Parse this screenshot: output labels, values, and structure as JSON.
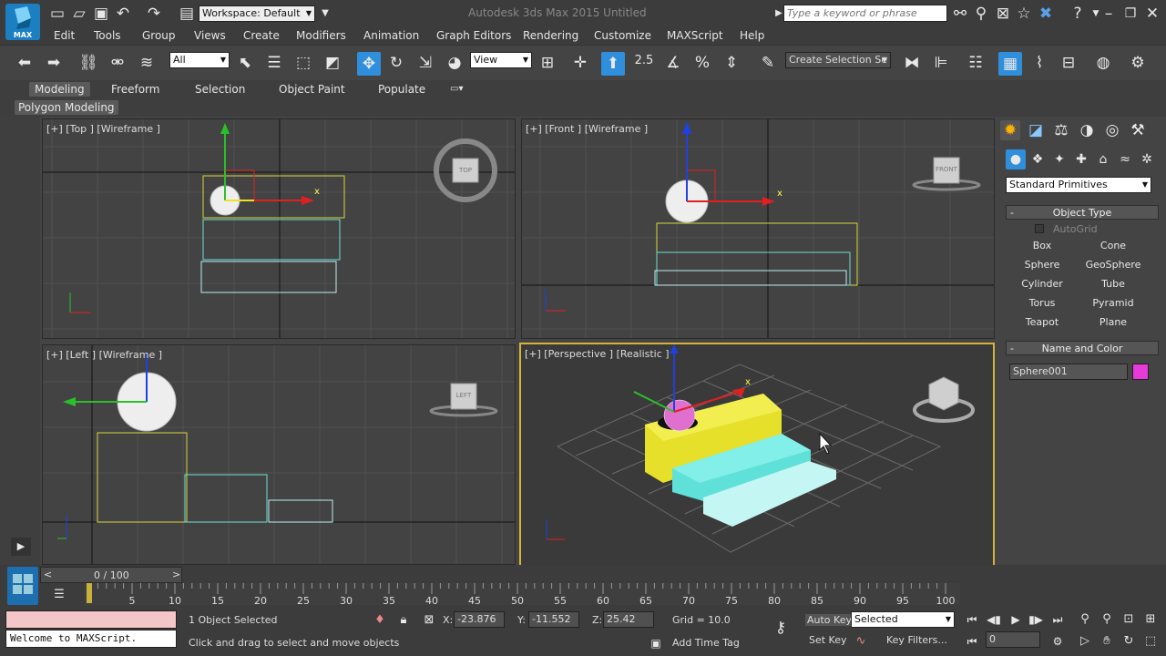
{
  "titlebar": {
    "app_logo": "MAX",
    "workspace_label": "Workspace: Default",
    "title": "Autodesk 3ds Max 2015    Untitled",
    "search_placeholder": "Type a keyword or phrase"
  },
  "menu": [
    "Edit",
    "Tools",
    "Group",
    "Views",
    "Create",
    "Modifiers",
    "Animation",
    "Graph Editors",
    "Rendering",
    "Customize",
    "MAXScript",
    "Help"
  ],
  "toolbar": {
    "selection_filter": "All",
    "ref_coord": "View",
    "snap_angle": "2.5",
    "named_selection_placeholder": "Create Selection Se"
  },
  "ribbon": {
    "tabs": [
      "Modeling",
      "Freeform",
      "Selection",
      "Object Paint",
      "Populate"
    ],
    "sub_label": "Polygon Modeling"
  },
  "viewports": {
    "top": {
      "label": "[+] [Top ] [Wireframe ]",
      "cube": "TOP"
    },
    "front": {
      "label": "[+] [Front ] [Wireframe ]",
      "cube": "FRONT"
    },
    "left": {
      "label": "[+] [Left ] [Wireframe ]",
      "cube": "LEFT"
    },
    "perspective": {
      "label": "[+] [Perspective ] [Realistic ]"
    },
    "axis_x": "x"
  },
  "command_panel": {
    "category": "Standard Primitives",
    "object_type_title": "Object Type",
    "autogrid": "AutoGrid",
    "buttons": [
      [
        "Box",
        "Cone"
      ],
      [
        "Sphere",
        "GeoSphere"
      ],
      [
        "Cylinder",
        "Tube"
      ],
      [
        "Torus",
        "Pyramid"
      ],
      [
        "Teapot",
        "Plane"
      ]
    ],
    "name_color_title": "Name and Color",
    "object_name": "Sphere001",
    "object_color": "#e83ad8"
  },
  "timeline": {
    "frame_counter": "0 / 100",
    "ticks": [
      "5",
      "10",
      "15",
      "20",
      "25",
      "30",
      "35",
      "40",
      "45",
      "50",
      "55",
      "60",
      "65",
      "70",
      "75",
      "80",
      "85",
      "90",
      "95",
      "100"
    ]
  },
  "status": {
    "maxscript_line": "Welcome to MAXScript.",
    "selection": "1 Object Selected",
    "prompt": "Click and drag to select and move objects",
    "x_label": "X:",
    "x_value": "-23.876",
    "y_label": "Y:",
    "y_value": "-11.552",
    "z_label": "Z:",
    "z_value": "25.42",
    "grid": "Grid = 10.0",
    "add_time_tag": "Add Time Tag",
    "auto_key": "Auto Key",
    "set_key": "Set Key",
    "selected_dropdown": "Selected",
    "key_filters": "Key Filters...",
    "frame_field": "0"
  },
  "colors": {
    "accent": "#2f8fdc",
    "active_viewport_border": "#d6b33a",
    "yellow_box": "#e6e02a",
    "cyan_box": "#5fe0d8"
  }
}
